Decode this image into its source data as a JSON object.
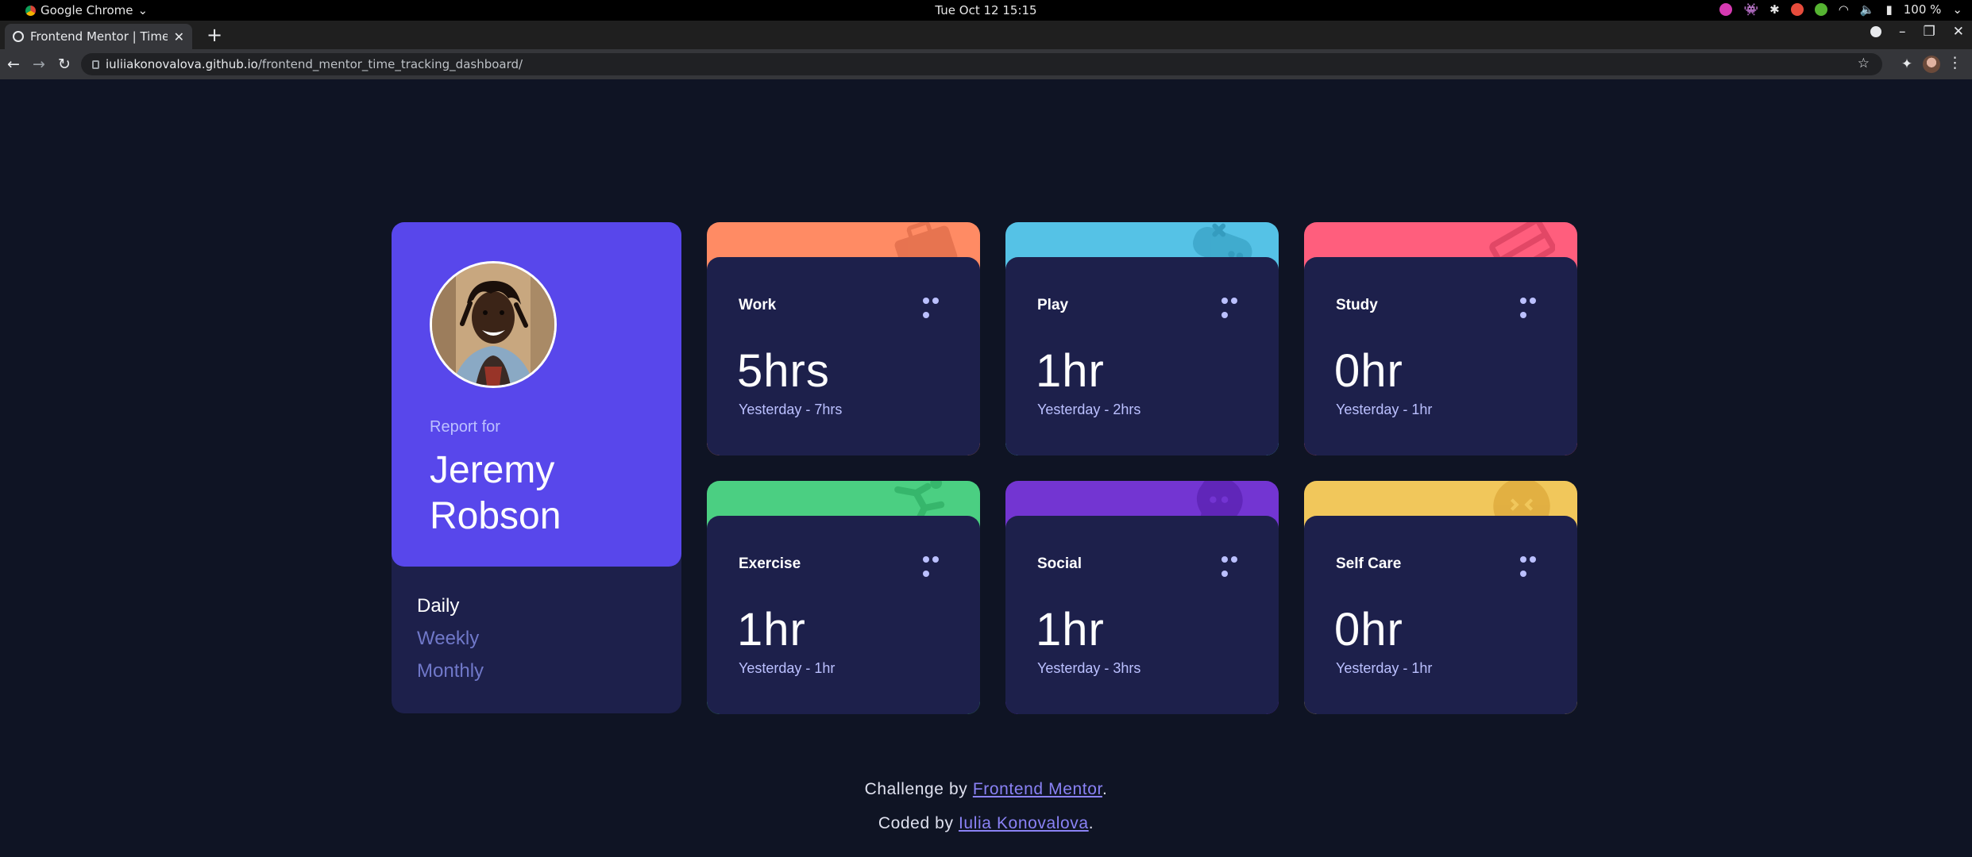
{
  "os": {
    "app_name": "Google Chrome",
    "app_chevron": "⌄",
    "clock": "Tue Oct 12  15:15",
    "battery": "100 %",
    "tray_icons": [
      {
        "name": "screen-recorder-icon",
        "color": "#d63ab2"
      },
      {
        "name": "alien-icon",
        "color": "#e6e6e6"
      },
      {
        "name": "slack-icon",
        "color": "#e6e6e6"
      },
      {
        "name": "tomato-timer-icon",
        "color": "#e74c3c"
      },
      {
        "name": "check-icon",
        "color": "#56b432"
      }
    ]
  },
  "browser": {
    "tab_title": "Frontend Mentor | Time tracking dashboard",
    "url_host": "iuliiakonovalova.github.io",
    "url_path": "/frontend_mentor_time_tracking_dashboard/"
  },
  "profile": {
    "report_label": "Report for",
    "name": "Jeremy Robson",
    "periods": [
      "Daily",
      "Weekly",
      "Monthly"
    ],
    "active_period": "Daily"
  },
  "cards": [
    {
      "title": "Work",
      "current": "5hrs",
      "previous": "Yesterday - 7hrs",
      "color": "#ff8b64",
      "icon": "briefcase-icon"
    },
    {
      "title": "Play",
      "current": "1hr",
      "previous": "Yesterday - 2hrs",
      "color": "#55c2e6",
      "icon": "gamepad-icon"
    },
    {
      "title": "Study",
      "current": "0hr",
      "previous": "Yesterday - 1hr",
      "color": "#ff5e7d",
      "icon": "book-icon"
    },
    {
      "title": "Exercise",
      "current": "1hr",
      "previous": "Yesterday - 1hr",
      "color": "#4bcf82",
      "icon": "runner-icon"
    },
    {
      "title": "Social",
      "current": "1hr",
      "previous": "Yesterday - 3hrs",
      "color": "#7335d2",
      "icon": "chat-bubble-icon"
    },
    {
      "title": "Self Care",
      "current": "0hr",
      "previous": "Yesterday - 1hr",
      "color": "#f1c75b",
      "icon": "heart-face-icon"
    }
  ],
  "footer": {
    "challenge_prefix": "Challenge by",
    "challenge_link": "Frontend Mentor",
    "coded_prefix": "Coded by",
    "coded_link": "Iulia Konovalova",
    "period": "."
  }
}
